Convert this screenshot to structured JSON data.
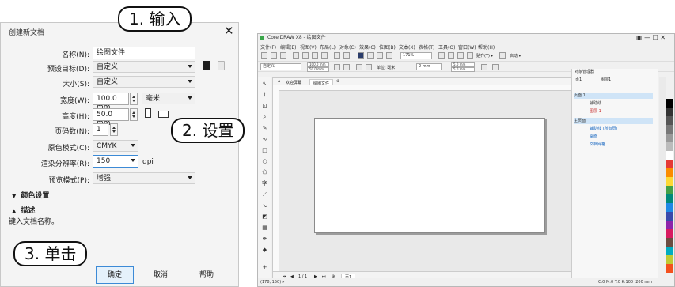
{
  "dialog": {
    "title": "创建新文档",
    "close_symbol": "✕",
    "fields": {
      "name_label": "名称(N):",
      "name_value": "绘图文件",
      "preset_label": "预设目标(D):",
      "preset_value": "自定义",
      "size_label": "大小(S):",
      "size_value": "自定义",
      "width_label": "宽度(W):",
      "width_value": "100.0 mm",
      "unit_value": "毫米",
      "height_label": "高度(H):",
      "height_value": "50.0 mm",
      "pages_label": "页码数(N):",
      "pages_value": "1",
      "color_mode_label": "原色模式(C):",
      "color_mode_value": "CMYK",
      "resolution_label": "渲染分辨率(R):",
      "resolution_value": "150",
      "resolution_unit": "dpi",
      "preview_label": "预览模式(P):",
      "preview_value": "增强"
    },
    "sections": {
      "color_settings": "颜色设置",
      "description": "描述"
    },
    "description_text": "键入文档名称。",
    "buttons": {
      "ok": "确定",
      "cancel": "取消",
      "help": "帮助"
    }
  },
  "callouts": {
    "step1": "1. 输入",
    "step2": "2. 设置",
    "step3": "3. 单击"
  },
  "app": {
    "title": "CorelDRAW X8 - 绘图文件",
    "window_controls": "▣  —  ☐  ✕",
    "menu": [
      "文件(F)",
      "编辑(E)",
      "视图(V)",
      "布局(L)",
      "对象(C)",
      "效果(C)",
      "位图(B)",
      "文本(X)",
      "表格(T)",
      "工具(O)",
      "窗口(W)",
      "帮助(H)"
    ],
    "zoom": "171%",
    "snap_label": "贴齐(T) ▾",
    "launch_label": "启动 ▾",
    "preset_combo": "自定义",
    "toolbar_width": "100.0 mm",
    "toolbar_height": "50.0 mm",
    "unit_label": "单位: 毫米",
    "nudge": "2 mm",
    "dup1": "5.0 mm",
    "dup2": "5.0 mm",
    "tabs": [
      "欢迎屏幕",
      "绘图文件"
    ],
    "page_nav": "1 / 1",
    "page_tab": "页1",
    "status_left": "(178, 150)  ▸",
    "status_right": "C:0 M:0 Y:0 K:100  .200 mm",
    "object_manager": {
      "title": "对象管理器",
      "page_label": "页1",
      "layer_label": "图层1",
      "rows": [
        "页面 1",
        "辅助线",
        "图层 1",
        "主页面",
        "辅助线 (所有页)",
        "桌面",
        "文档网格"
      ]
    }
  },
  "palette": [
    "#000000",
    "#333333",
    "#555555",
    "#777777",
    "#999999",
    "#bbbbbb",
    "#ffffff",
    "#e53935",
    "#fb8c00",
    "#fdd835",
    "#43a047",
    "#00897b",
    "#1e88e5",
    "#3949ab",
    "#8e24aa",
    "#d81b60",
    "#6d4c41",
    "#00acc1",
    "#c0ca33",
    "#f4511e"
  ]
}
